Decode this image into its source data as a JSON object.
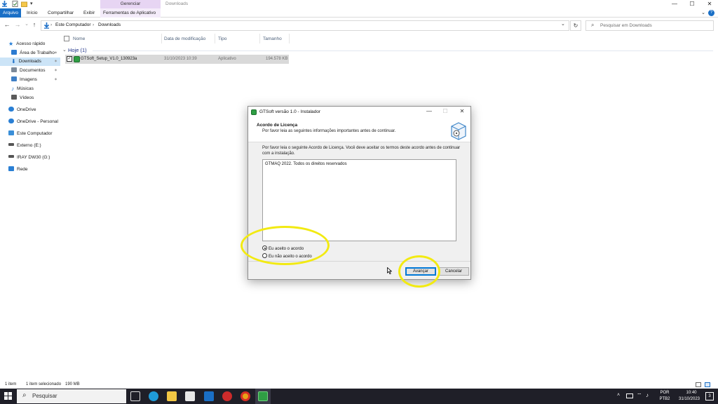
{
  "ribbon": {
    "context_group": "Gerenciar",
    "window_title": "Downloads",
    "tabs": [
      "Arquivo",
      "Início",
      "Compartilhar",
      "Exibir",
      "Ferramentas de Aplicativo"
    ],
    "help": "?"
  },
  "window_controls": {
    "minimize": "—",
    "maximize": "☐",
    "close": "✕"
  },
  "address": {
    "back": "←",
    "forward": "→",
    "recent": "⌄",
    "up": "↑",
    "crumbs": [
      "Este Computador",
      "Downloads"
    ],
    "separator": "›",
    "dropdown": "⌄",
    "refresh": "↻",
    "search_placeholder": "Pesquisar em Downloads",
    "search_icon": "⌕"
  },
  "nav": {
    "items": [
      {
        "label": "Acesso rápido",
        "icon": "star-icon",
        "color": "#1e7ad6"
      },
      {
        "label": "Área de Trabalho",
        "icon": "desktop-icon",
        "color": "#2b7bd1"
      },
      {
        "label": "Downloads",
        "icon": "download-icon",
        "color": "#1c6fc8"
      },
      {
        "label": "Documentos",
        "icon": "documents-icon",
        "color": "#7d8a99"
      },
      {
        "label": "Imagens",
        "icon": "pictures-icon",
        "color": "#3f7fc6"
      },
      {
        "label": "Músicas",
        "icon": "music-icon",
        "color": "#1c6fc8"
      },
      {
        "label": "Vídeos",
        "icon": "video-icon",
        "color": "#5b5b5b"
      },
      {
        "label": "OneDrive",
        "icon": "cloud-icon",
        "color": "#2a7fd4"
      },
      {
        "label": "OneDrive - Personal",
        "icon": "cloud-icon",
        "color": "#2a7fd4"
      },
      {
        "label": "Este Computador",
        "icon": "computer-icon",
        "color": "#3a8fd8"
      },
      {
        "label": "Externo (E:)",
        "icon": "drive-icon",
        "color": "#555555"
      },
      {
        "label": "IRAY DW30 (G:)",
        "icon": "drive-icon",
        "color": "#555555"
      },
      {
        "label": "Rede",
        "icon": "network-icon",
        "color": "#2a7fd4"
      }
    ],
    "pin": "✶"
  },
  "columns": [
    "Nome",
    "Data de modificação",
    "Tipo",
    "Tamanho"
  ],
  "group": "Hoje (1)",
  "file": {
    "name": "GTSoft_Setup_V1.0_130923a",
    "modified": "31/10/2023 10:39",
    "type": "Aplicativo",
    "size": "194.578 KB"
  },
  "dialog": {
    "title": "GTSoft versão 1.0 - Instalador",
    "heading": "Acordo de Licença",
    "subheading": "Por favor leia as seguintes informações importantes antes de continuar.",
    "intro": "Por favor leia o seguinte Acordo de Licença. Você deve aceitar os termos deste acordo antes de continuar com a instalação.",
    "license_text": "GTMAQ 2022. Todos os direitos reservados",
    "radio_accept": "Eu aceito o acordo",
    "radio_decline": "Eu não aceito o acordo",
    "next": "Avançar",
    "cancel": "Cancelar",
    "highlight_color": "#f2ea12"
  },
  "status": {
    "count": "1 item",
    "selected": "1 item selecionado",
    "size": "190 MB"
  },
  "taskbar": {
    "search_placeholder": "Pesquisar",
    "lang": "POR",
    "layout": "PTB2",
    "time": "10:40",
    "date": "31/10/2023",
    "notifications": "3"
  }
}
